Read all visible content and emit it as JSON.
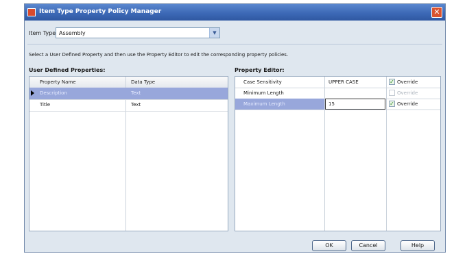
{
  "window": {
    "title": "Item Type Property Policy Manager"
  },
  "item_type": {
    "label": "Item Type:",
    "value": "Assembly"
  },
  "instruction": "Select a User Defined Property and then use the Property Editor to edit the corresponding property policies.",
  "udp": {
    "title": "User Defined Properties:",
    "columns": [
      "Property Name",
      "Data Type"
    ],
    "rows": [
      {
        "name": "Description",
        "type": "Text"
      },
      {
        "name": "Title",
        "type": "Text"
      }
    ]
  },
  "editor": {
    "title": "Property Editor:",
    "rows": [
      {
        "name": "Case Sensitivity",
        "value": "UPPER CASE",
        "override": "Override"
      },
      {
        "name": "Minimum Length",
        "value": "",
        "override": "Override"
      },
      {
        "name": "Maximum Length",
        "value": "15",
        "override": "Override"
      }
    ]
  },
  "buttons": {
    "ok": "OK",
    "cancel": "Cancel",
    "help": "Help"
  },
  "icons": {
    "app": "app-icon",
    "close": "close-icon",
    "dropdown": "chevron-down-icon",
    "row_marker": "row-pointer-icon",
    "check": "checkmark-icon"
  }
}
